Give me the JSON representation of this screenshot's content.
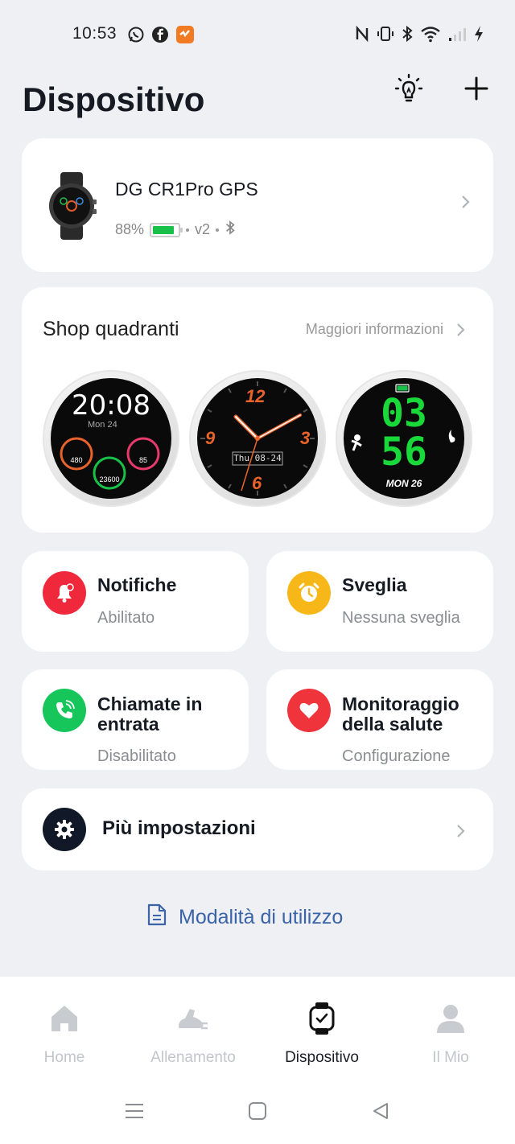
{
  "status_bar": {
    "time": "10:53",
    "left_icons": [
      "whatsapp-icon",
      "facebook-icon",
      "app-notification-icon"
    ],
    "right_icons": [
      "nfc-icon",
      "vibrate-icon",
      "bluetooth-icon",
      "wifi-icon",
      "signal-icon",
      "charging-icon"
    ]
  },
  "header": {
    "title": "Dispositivo",
    "icons": [
      "lightbulb-icon",
      "plus-icon"
    ]
  },
  "device": {
    "name": "DG CR1Pro GPS",
    "battery": "88%",
    "battery_level": 0.88,
    "battery_color": "#19c14a",
    "version": "v2"
  },
  "shop": {
    "title": "Shop quadranti",
    "more_label": "Maggiori informazioni",
    "faces": [
      {
        "time": "20:08",
        "date": "Mon 24",
        "stat_left": "480",
        "stat_right": "85",
        "stat_bottom": "23600"
      },
      {
        "numbers": [
          "12",
          "3",
          "6",
          "9"
        ],
        "date": "Thu 08-24"
      },
      {
        "hours": "03",
        "minutes": "56",
        "date": "MON 26"
      }
    ]
  },
  "tiles": [
    {
      "title": "Notifiche",
      "subtitle": "Abilitato",
      "color": "#f0283c"
    },
    {
      "title": "Sveglia",
      "subtitle": "Nessuna sveglia",
      "color": "#f7b718"
    },
    {
      "title_line1": "Chiamate in",
      "title_line2": "entrata",
      "subtitle": "Disabilitato",
      "color": "#16c65a"
    },
    {
      "title_line1": "Monitoraggio",
      "title_line2": "della salute",
      "subtitle": "Configurazione",
      "color": "#f0343c"
    }
  ],
  "settings": {
    "label": "Più impostazioni"
  },
  "usage": {
    "label": "Modalità di utilizzo"
  },
  "bottom_nav": [
    {
      "label": "Home",
      "icon": "home-icon"
    },
    {
      "label": "Allenamento",
      "icon": "sneaker-icon"
    },
    {
      "label": "Dispositivo",
      "icon": "watch-icon",
      "active": true
    },
    {
      "label": "Il Mio",
      "icon": "person-icon"
    }
  ],
  "accent_color": "#3a63a8"
}
